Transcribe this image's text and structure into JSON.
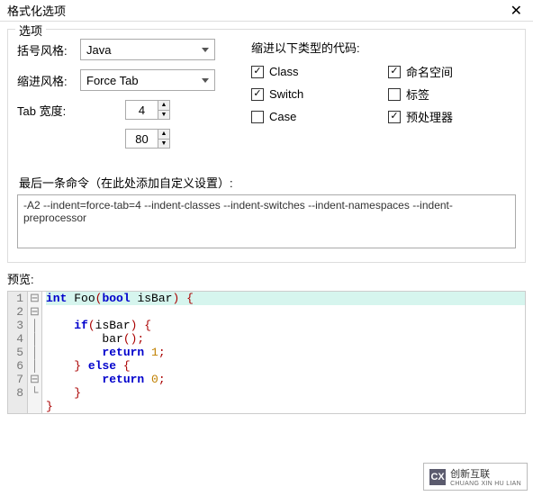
{
  "window": {
    "title": "格式化选项"
  },
  "options": {
    "section_label": "选项",
    "brace_style_label": "括号风格:",
    "brace_style_value": "Java",
    "indent_style_label": "缩进风格:",
    "indent_style_value": "Force Tab",
    "tab_width_label": "Tab 宽度:",
    "tab_width_value": "4",
    "width_value": "80",
    "indent_types_label": "缩进以下类型的代码:",
    "checks": {
      "class": {
        "label": "Class",
        "checked": true
      },
      "namespace": {
        "label": "命名空间",
        "checked": true
      },
      "switch": {
        "label": "Switch",
        "checked": true
      },
      "label": {
        "label": "标签",
        "checked": false
      },
      "case": {
        "label": "Case",
        "checked": false
      },
      "preprocessor": {
        "label": "预处理器",
        "checked": true
      }
    },
    "last_cmd_label": "最后一条命令（在此处添加自定义设置）:",
    "last_cmd_value": "-A2 --indent=force-tab=4 --indent-classes --indent-switches --indent-namespaces --indent-preprocessor"
  },
  "preview": {
    "label": "预览:",
    "lines": [
      "int Foo(bool isBar) {",
      "    if(isBar) {",
      "        bar();",
      "        return 1;",
      "    } else {",
      "        return 0;",
      "    }",
      "}"
    ]
  },
  "watermark": {
    "logo": "CX",
    "line1": "创新互联",
    "line2": "CHUANG XIN HU LIAN"
  },
  "colors": {
    "highlight": "#d6f5ee",
    "arrow": "#ff3030"
  }
}
